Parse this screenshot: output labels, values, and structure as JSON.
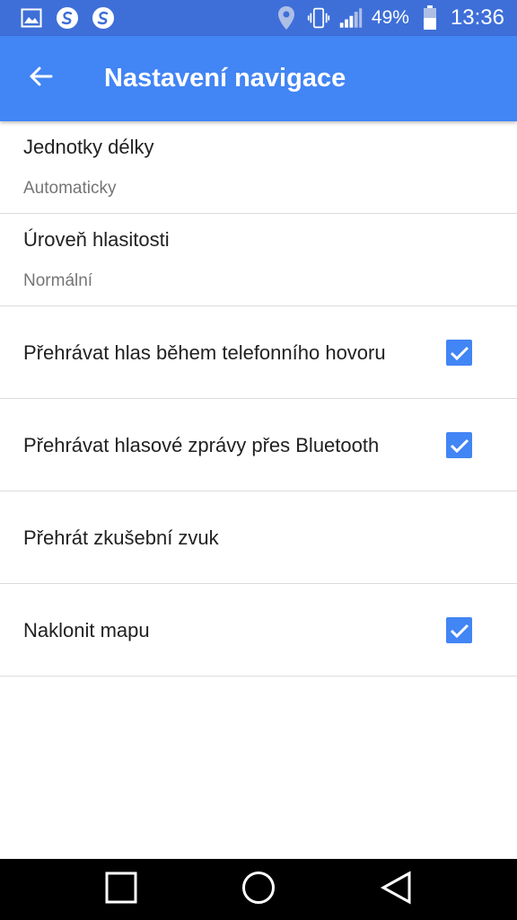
{
  "status_bar": {
    "battery": "49%",
    "time": "13:36",
    "icons": [
      "image-icon",
      "swype-icon",
      "swype-icon",
      "location-icon",
      "vibrate-icon",
      "signal-icon",
      "battery-icon"
    ]
  },
  "app_bar": {
    "title": "Nastavení navigace",
    "back_icon": "arrow-back-icon"
  },
  "settings": [
    {
      "title": "Jednotky délky",
      "subtitle": "Automaticky"
    },
    {
      "title": "Úroveň hlasitosti",
      "subtitle": "Normální"
    },
    {
      "title": "Přehrávat hlas během telefonního hovoru",
      "checked": true
    },
    {
      "title": "Přehrávat hlasové zprávy přes Bluetooth",
      "checked": true
    },
    {
      "title": "Přehrát zkušební zvuk"
    },
    {
      "title": "Naklonit mapu",
      "checked": true
    }
  ],
  "nav_bar": {
    "icons": [
      "recents-icon",
      "home-icon",
      "back-icon"
    ]
  },
  "colors": {
    "status_bar": "#3e6fd8",
    "app_bar": "#4285f4",
    "checkbox": "#4285f4",
    "nav_bar": "#000000"
  }
}
